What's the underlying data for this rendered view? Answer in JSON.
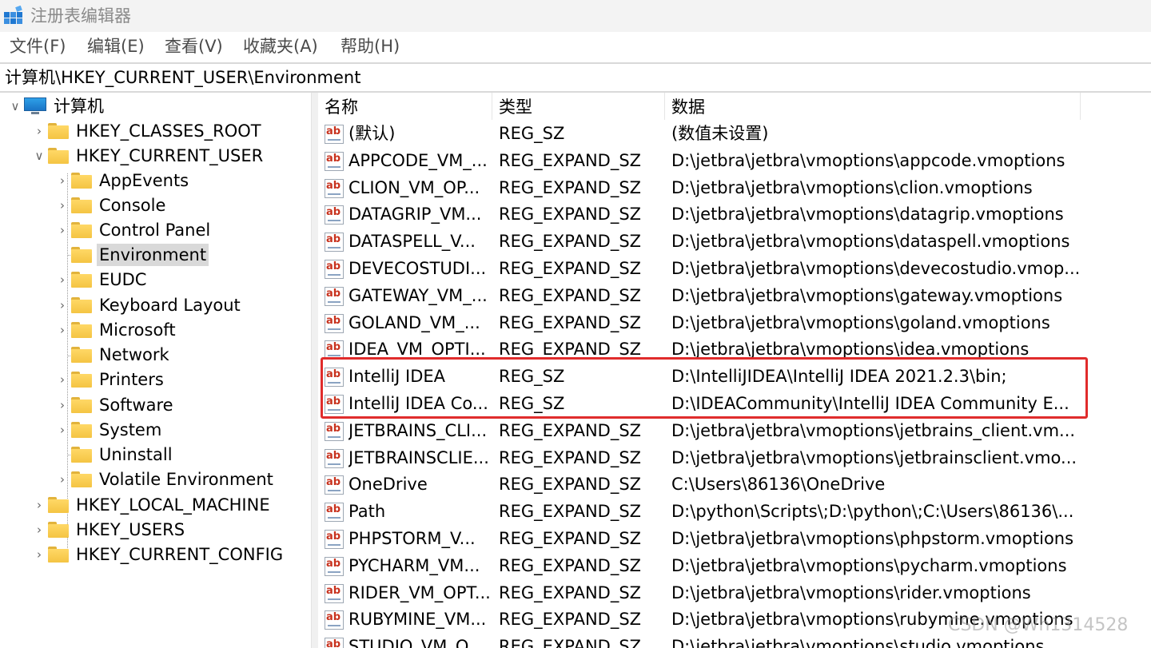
{
  "window": {
    "title": "注册表编辑器"
  },
  "menu": [
    "文件(F)",
    "编辑(E)",
    "查看(V)",
    "收藏夹(A)",
    "帮助(H)"
  ],
  "address": "计算机\\HKEY_CURRENT_USER\\Environment",
  "tree": {
    "root": "计算机",
    "items": [
      {
        "label": "HKEY_CLASSES_ROOT"
      },
      {
        "label": "HKEY_CURRENT_USER"
      },
      {
        "label": "AppEvents"
      },
      {
        "label": "Console"
      },
      {
        "label": "Control Panel"
      },
      {
        "label": "Environment"
      },
      {
        "label": "EUDC"
      },
      {
        "label": "Keyboard Layout"
      },
      {
        "label": "Microsoft"
      },
      {
        "label": "Network"
      },
      {
        "label": "Printers"
      },
      {
        "label": "Software"
      },
      {
        "label": "System"
      },
      {
        "label": "Uninstall"
      },
      {
        "label": "Volatile Environment"
      },
      {
        "label": "HKEY_LOCAL_MACHINE"
      },
      {
        "label": "HKEY_USERS"
      },
      {
        "label": "HKEY_CURRENT_CONFIG"
      }
    ],
    "selected": "Environment"
  },
  "list": {
    "columns": [
      "名称",
      "类型",
      "数据"
    ],
    "rows": [
      {
        "name": "(默认)",
        "type": "REG_SZ",
        "data": "(数值未设置)"
      },
      {
        "name": "APPCODE_VM_...",
        "type": "REG_EXPAND_SZ",
        "data": "D:\\jetbra\\jetbra\\vmoptions\\appcode.vmoptions"
      },
      {
        "name": "CLION_VM_OP...",
        "type": "REG_EXPAND_SZ",
        "data": "D:\\jetbra\\jetbra\\vmoptions\\clion.vmoptions"
      },
      {
        "name": "DATAGRIP_VM...",
        "type": "REG_EXPAND_SZ",
        "data": "D:\\jetbra\\jetbra\\vmoptions\\datagrip.vmoptions"
      },
      {
        "name": "DATASPELL_V...",
        "type": "REG_EXPAND_SZ",
        "data": "D:\\jetbra\\jetbra\\vmoptions\\dataspell.vmoptions"
      },
      {
        "name": "DEVECOSTUDI...",
        "type": "REG_EXPAND_SZ",
        "data": "D:\\jetbra\\jetbra\\vmoptions\\devecostudio.vmop..."
      },
      {
        "name": "GATEWAY_VM_...",
        "type": "REG_EXPAND_SZ",
        "data": "D:\\jetbra\\jetbra\\vmoptions\\gateway.vmoptions"
      },
      {
        "name": "GOLAND_VM_...",
        "type": "REG_EXPAND_SZ",
        "data": "D:\\jetbra\\jetbra\\vmoptions\\goland.vmoptions"
      },
      {
        "name": "IDEA_VM_OPTI...",
        "type": "REG_EXPAND_SZ",
        "data": "D:\\jetbra\\jetbra\\vmoptions\\idea.vmoptions"
      },
      {
        "name": "IntelliJ IDEA",
        "type": "REG_SZ",
        "data": "D:\\IntelliJIDEA\\IntelliJ IDEA 2021.2.3\\bin;"
      },
      {
        "name": "IntelliJ IDEA Co...",
        "type": "REG_SZ",
        "data": "D:\\IDEACommunity\\IntelliJ IDEA Community E..."
      },
      {
        "name": "JETBRAINS_CLI...",
        "type": "REG_EXPAND_SZ",
        "data": "D:\\jetbra\\jetbra\\vmoptions\\jetbrains_client.vm..."
      },
      {
        "name": "JETBRAINSCLIE...",
        "type": "REG_EXPAND_SZ",
        "data": "D:\\jetbra\\jetbra\\vmoptions\\jetbrainsclient.vmo..."
      },
      {
        "name": "OneDrive",
        "type": "REG_EXPAND_SZ",
        "data": "C:\\Users\\86136\\OneDrive"
      },
      {
        "name": "Path",
        "type": "REG_EXPAND_SZ",
        "data": "D:\\python\\Scripts\\;D:\\python\\;C:\\Users\\86136\\..."
      },
      {
        "name": "PHPSTORM_V...",
        "type": "REG_EXPAND_SZ",
        "data": "D:\\jetbra\\jetbra\\vmoptions\\phpstorm.vmoptions"
      },
      {
        "name": "PYCHARM_VM...",
        "type": "REG_EXPAND_SZ",
        "data": "D:\\jetbra\\jetbra\\vmoptions\\pycharm.vmoptions"
      },
      {
        "name": "RIDER_VM_OPT...",
        "type": "REG_EXPAND_SZ",
        "data": "D:\\jetbra\\jetbra\\vmoptions\\rider.vmoptions"
      },
      {
        "name": "RUBYMINE_VM...",
        "type": "REG_EXPAND_SZ",
        "data": "D:\\jetbra\\jetbra\\vmoptions\\rubymine.vmoptions"
      },
      {
        "name": "STUDIO_VM_O...",
        "type": "REG_EXPAND_SZ",
        "data": "D:\\jetbra\\jetbra\\vmoptions\\studio.vmoptions"
      }
    ]
  },
  "annotation": {
    "color": "#e02c2c"
  },
  "watermark": "CSDN @Wh1314528",
  "colors": {
    "selection": "#d9d9d9",
    "folder": "#f4c443"
  }
}
